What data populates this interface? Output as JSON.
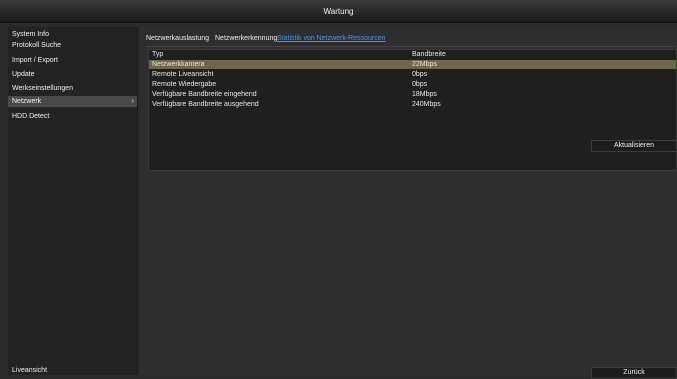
{
  "window": {
    "title": "Wartung"
  },
  "sidebar": {
    "items": [
      {
        "label": "System Info"
      },
      {
        "label": "Protokoll Suche"
      },
      {
        "label": "Import / Export"
      },
      {
        "label": "Update"
      },
      {
        "label": "Werkseinstellungen"
      },
      {
        "label": "Netzwerk",
        "active": true,
        "chevron": "›"
      },
      {
        "label": "HDD Detect"
      }
    ],
    "bottom_label": "Liveansicht"
  },
  "tabs": [
    {
      "label": "Netzwerkauslastung"
    },
    {
      "label": "Netzwerkerkennung"
    },
    {
      "label": "Statistik von Netzwerk-Ressourcen",
      "active": true
    }
  ],
  "table": {
    "headers": [
      "Typ",
      "Bandbreite"
    ],
    "rows": [
      [
        "Netzwerkkamera",
        "22Mbps"
      ],
      [
        "Remote Liveansicht",
        "0bps"
      ],
      [
        "Remote Wiedergabe",
        "0bps"
      ],
      [
        "Verfügbare Bandbreite eingehend",
        "18Mbps"
      ],
      [
        "Verfügbare Bandbreite ausgehend",
        "240Mbps"
      ]
    ],
    "selected_row": 0
  },
  "buttons": {
    "refresh": "Aktualisieren",
    "back": "Zurück"
  },
  "colors": {
    "accent": "#3a9bff",
    "selected_row": "#6f6749",
    "background": "#2b2b2b"
  }
}
